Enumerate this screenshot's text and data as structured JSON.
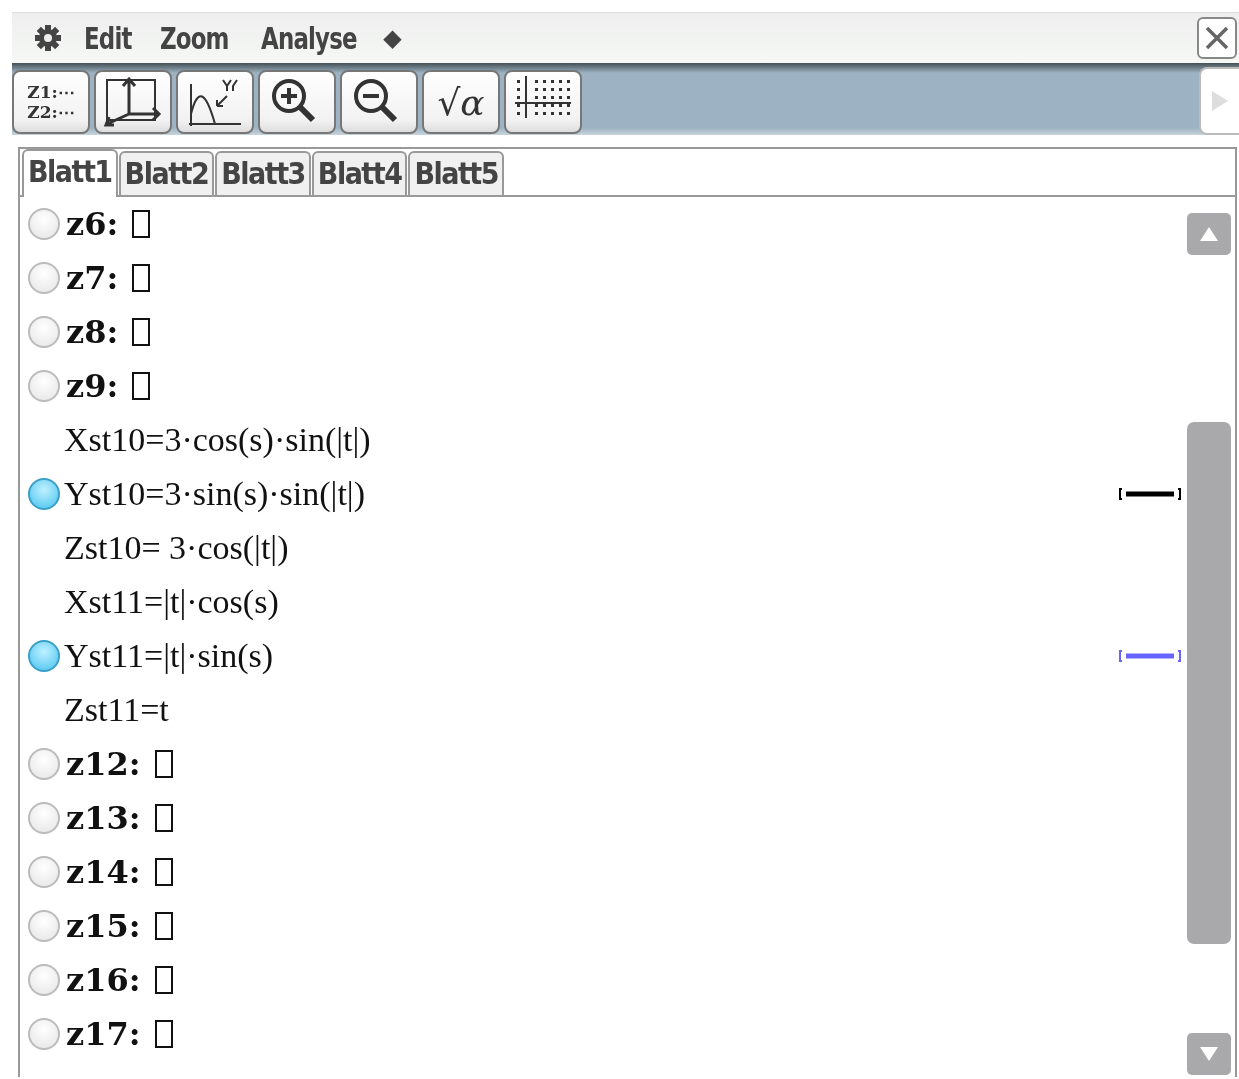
{
  "menu": {
    "items": [
      "Edit",
      "Zoom",
      "Analyse"
    ],
    "more": "◆"
  },
  "toolbar": [
    {
      "kind": "list",
      "lines": [
        "Z1:⋯",
        "Z2:⋯"
      ]
    },
    {
      "kind": "axes"
    },
    {
      "kind": "trace"
    },
    {
      "kind": "zoom-in"
    },
    {
      "kind": "zoom-out"
    },
    {
      "kind": "text",
      "label": "√α"
    },
    {
      "kind": "grid"
    }
  ],
  "tabs": [
    {
      "label": "Blatt1",
      "selected": true
    },
    {
      "label": "Blatt2",
      "selected": false
    },
    {
      "label": "Blatt3",
      "selected": false
    },
    {
      "label": "Blatt4",
      "selected": false
    },
    {
      "label": "Blatt5",
      "selected": false
    }
  ],
  "rows": [
    {
      "kind": "empty",
      "label": "z6:",
      "checked": false
    },
    {
      "kind": "empty",
      "label": "z7:",
      "checked": false
    },
    {
      "kind": "empty",
      "label": "z8:",
      "checked": false
    },
    {
      "kind": "empty",
      "label": "z9:",
      "checked": false
    },
    {
      "kind": "part",
      "text": "Xst10=3·cos(s)·sin(|t|)"
    },
    {
      "kind": "head",
      "text": "Yst10=3·sin(s)·sin(|t|)",
      "checked": true,
      "color": "#000000"
    },
    {
      "kind": "part",
      "text": "Zst10= 3·cos(|t|)"
    },
    {
      "kind": "part",
      "text": "Xst11=|t|·cos(s)"
    },
    {
      "kind": "head",
      "text": "Yst11=|t|·sin(s)",
      "checked": true,
      "color": "#6666ff"
    },
    {
      "kind": "part",
      "text": "Zst11=t"
    },
    {
      "kind": "empty",
      "label": "z12:",
      "checked": false
    },
    {
      "kind": "empty",
      "label": "z13:",
      "checked": false
    },
    {
      "kind": "empty",
      "label": "z14:",
      "checked": false
    },
    {
      "kind": "empty",
      "label": "z15:",
      "checked": false
    },
    {
      "kind": "empty",
      "label": "z16:",
      "checked": false
    },
    {
      "kind": "empty",
      "label": "z17:",
      "checked": false
    }
  ]
}
